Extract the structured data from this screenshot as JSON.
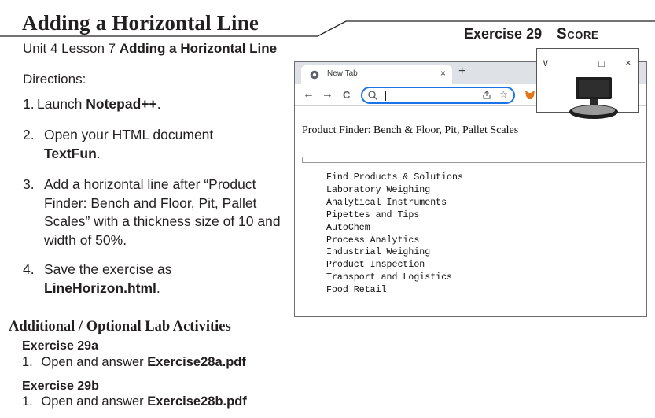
{
  "header": {
    "title": "Adding a Horizontal Line",
    "exercise": "Exercise 29",
    "score": "Score"
  },
  "unit": {
    "prefix": "Unit 4 Lesson 7",
    "lesson_title": "Adding a Horizontal Line"
  },
  "directions_label": "Directions:",
  "steps": [
    {
      "num": "1.",
      "text_a": "Launch ",
      "bold_a": "Notepad++",
      "text_b": "."
    },
    {
      "num": "2.",
      "text_a": "Open your HTML document ",
      "bold_a": "TextFun",
      "text_b": "."
    },
    {
      "num": "3.",
      "text_a": "Add a horizontal line after “Product Finder: Bench and Floor, Pit, Pallet Scales” with a thickness size of 10 and width of 50%."
    },
    {
      "num": "4.",
      "text_a": "Save the exercise as ",
      "bold_a": "LineHorizon.html",
      "text_b": "."
    }
  ],
  "additional": {
    "heading": "Additional / Optional Lab Activities",
    "exercises": [
      {
        "title": "Exercise 29a",
        "num": "1.",
        "text": "Open and answer ",
        "file": "Exercise28a.pdf"
      },
      {
        "title": "Exercise 29b",
        "num": "1.",
        "text": "Open and answer ",
        "file": "Exercise28b.pdf"
      }
    ]
  },
  "browser": {
    "tab_title": "New Tab",
    "tab_close": "×",
    "new_tab": "+",
    "nav": {
      "back": "←",
      "forward": "→",
      "reload": "C"
    },
    "omnibox_value": "",
    "page_heading": "Product Finder: Bench & Floor, Pit, Pallet Scales",
    "list": [
      "Find Products & Solutions",
      "Laboratory Weighing",
      "Analytical Instruments",
      "Pipettes and Tips",
      "AutoChem",
      "Process Analytics",
      "Industrial Weighing",
      "Product Inspection",
      "Transport and Logistics",
      "Food Retail"
    ],
    "window_controls": {
      "chevron": "∨",
      "minimize": "–",
      "maximize": "□",
      "close": "×"
    }
  },
  "colors": {
    "text": "#231f20",
    "accent_blue": "#1a73e8",
    "tabstrip": "#dee1e6"
  }
}
